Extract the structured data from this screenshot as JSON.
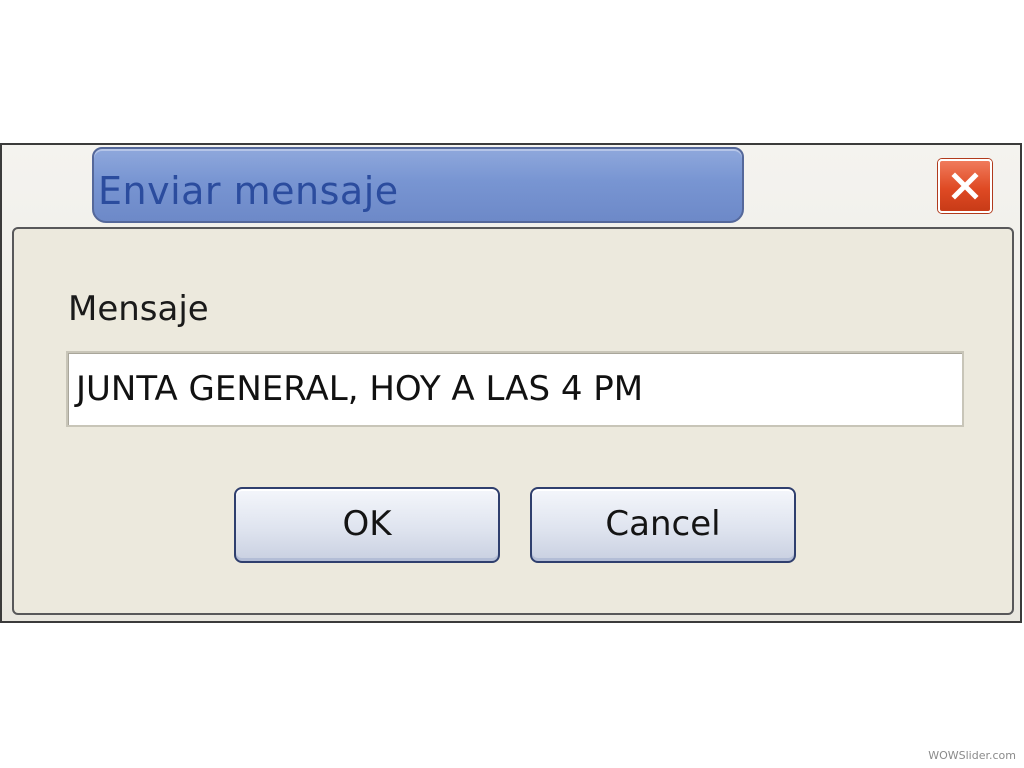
{
  "dialog": {
    "title": "Enviar mensaje",
    "close_icon": "close-icon",
    "message_label": "Mensaje",
    "message_value": "JUNTA GENERAL, HOY A LAS 4 PM",
    "ok_label": "OK",
    "cancel_label": "Cancel"
  },
  "watermark": "WOWSlider.com",
  "colors": {
    "title_pill": "#7895d2",
    "title_text": "#2b4c9e",
    "close_button": "#df4a24",
    "client_background": "#ece9dd"
  }
}
